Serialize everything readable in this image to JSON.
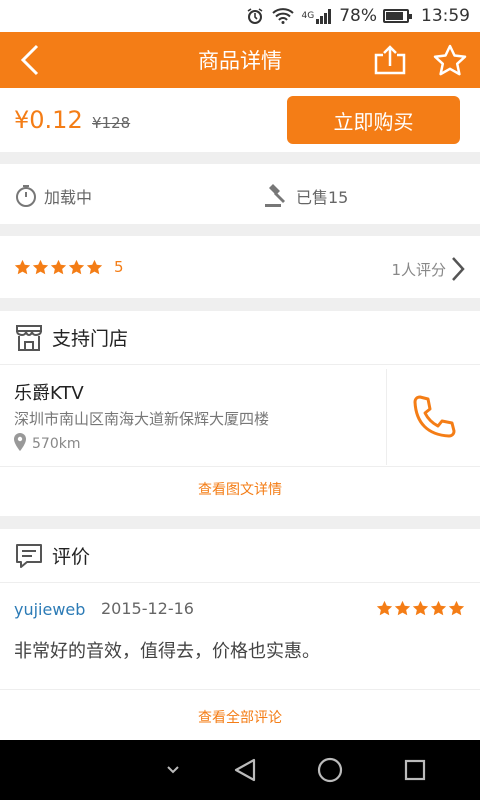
{
  "status_bar": {
    "network": "4G",
    "battery": "78%",
    "time": "13:59"
  },
  "header": {
    "title": "商品详情"
  },
  "price_section": {
    "price": "¥0.12",
    "original_price": "¥128",
    "buy_button": "立即购买"
  },
  "info": {
    "loading": "加载中",
    "sold": "已售15"
  },
  "rating": {
    "score": "5",
    "star_count": 5,
    "review_count": "1人评分"
  },
  "store_section": {
    "title": "支持门店",
    "name": "乐爵KTV",
    "address": "深圳市南山区南海大道新保辉大厦四楼",
    "distance": "570km",
    "view_details_link": "查看图文详情"
  },
  "review_section": {
    "title": "评价",
    "review": {
      "user": "yujieweb",
      "date": "2015-12-16",
      "stars": 5,
      "text": "非常好的音效，值得去，价格也实惠。"
    },
    "view_all_link": "查看全部评论"
  },
  "colors": {
    "accent": "#f47d16",
    "username": "#2c7bb6"
  },
  "icons": [
    "back-icon",
    "share-icon",
    "star-outline-icon",
    "timer-icon",
    "gavel-icon",
    "chevron-right-icon",
    "store-icon",
    "phone-icon",
    "location-pin-icon",
    "comment-icon"
  ]
}
